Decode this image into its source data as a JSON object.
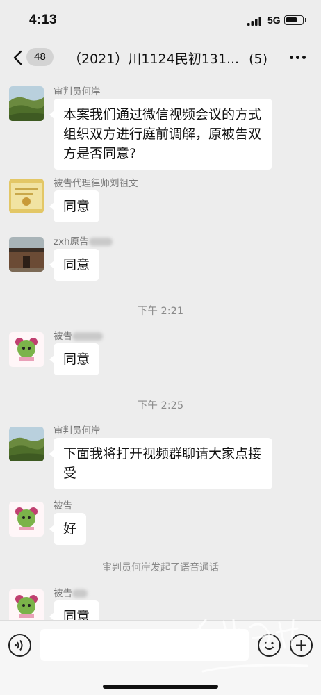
{
  "status_bar": {
    "time": "4:13",
    "network": "5G",
    "battery_level": 0.72,
    "icons": [
      "signal-icon",
      "battery-icon"
    ]
  },
  "nav": {
    "unread_count": "48",
    "title": "（2021）川1124民初131...",
    "member_count": "(5)",
    "icons": [
      "back-icon",
      "more-icon"
    ]
  },
  "messages": [
    {
      "sender": "审判员何岸",
      "text": "本案我们通过微信视频会议的方式组织双方进行庭前调解，原被告双方是否同意?",
      "avatar": "landscape-avatar"
    },
    {
      "sender": "被告代理律师刘祖文",
      "text": "同意",
      "avatar": "document-avatar"
    },
    {
      "sender": "zxh原告",
      "text": "同意",
      "avatar": "house-avatar"
    },
    {
      "sender": "被告",
      "text": "同意",
      "avatar": "cartoon-avatar"
    },
    {
      "sender": "审判员何岸",
      "text": "下面我将打开视频群聊请大家点接受",
      "avatar": "landscape-avatar"
    },
    {
      "sender": "被告",
      "text": "好",
      "avatar": "cartoon-avatar"
    },
    {
      "sender": "被告",
      "text": "同意",
      "avatar": "cartoon-avatar"
    }
  ],
  "time_dividers": [
    "下午 2:21",
    "下午 2:25"
  ],
  "system_notice": "审判员何岸发起了语音通话",
  "input_bar": {
    "icons": [
      "voice-icon",
      "emoji-icon",
      "plus-icon"
    ]
  },
  "colors": {
    "background": "#ededed",
    "bubble": "#ffffff",
    "meta_text": "#8a8a8a"
  }
}
